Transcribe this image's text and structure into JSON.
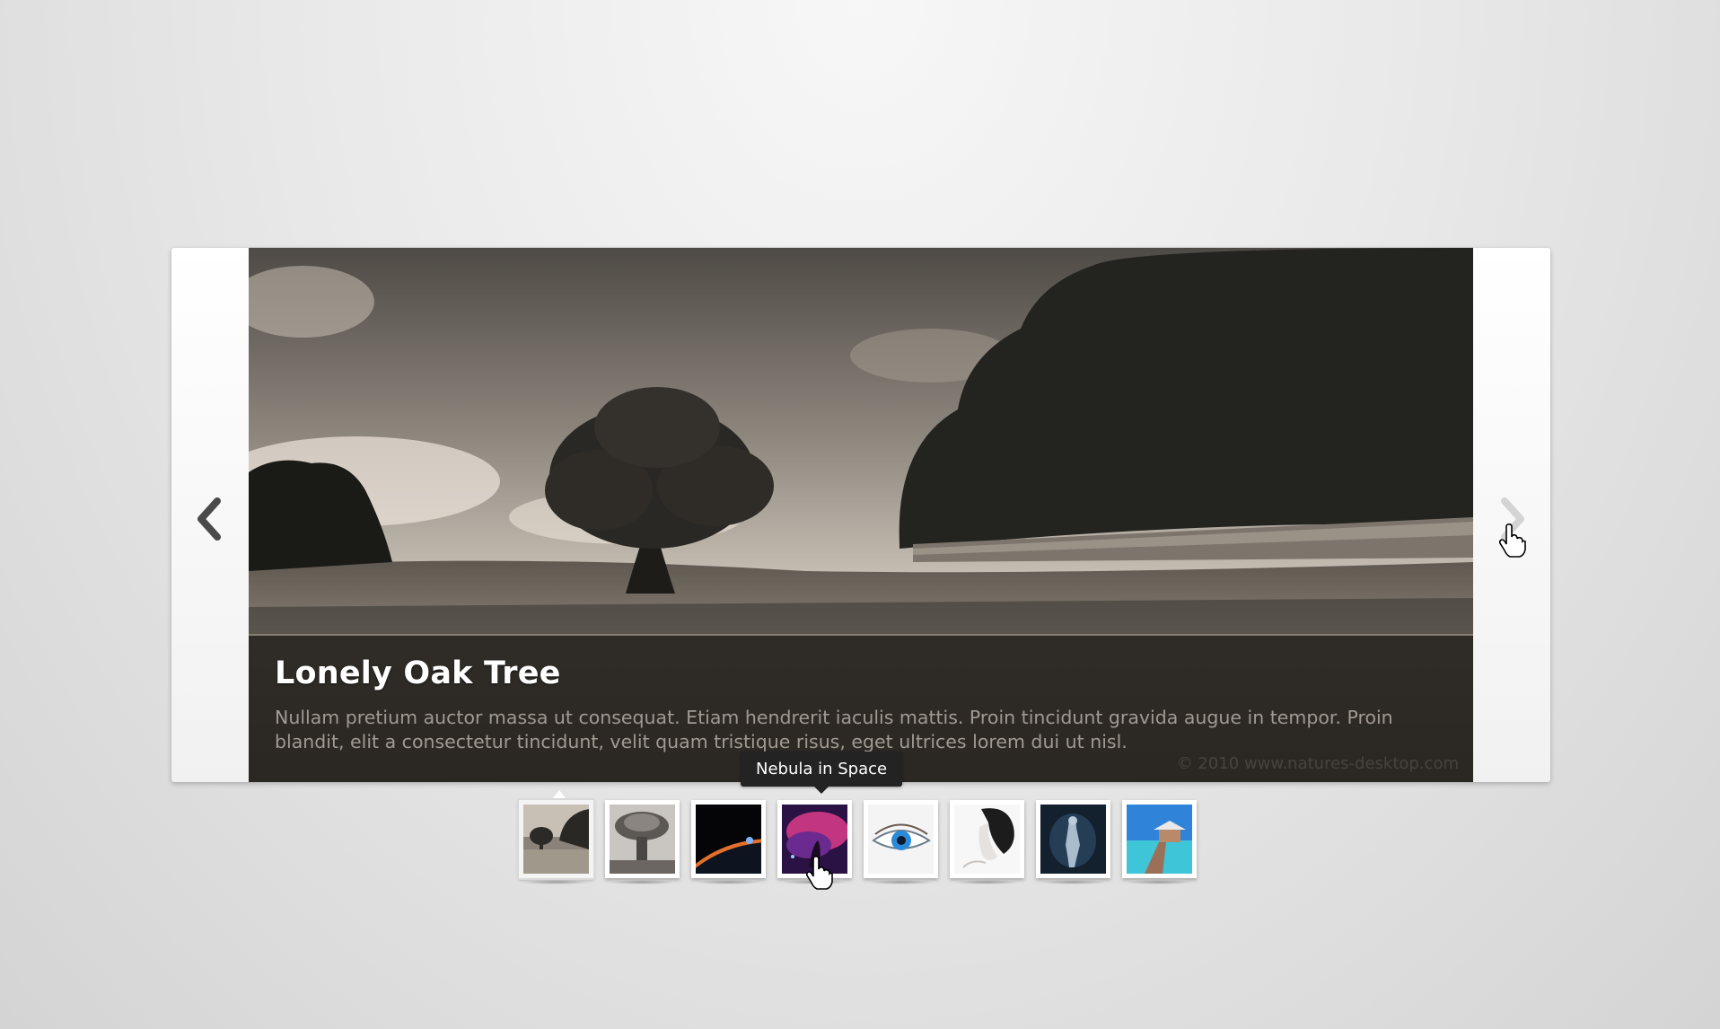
{
  "slide": {
    "title": "Lonely Oak Tree",
    "description": "Nullam pretium auctor massa ut consequat. Etiam hendrerit iaculis mattis. Proin tincidunt gravida augue in tempor. Proin blandit, elit a consectetur tincidunt, velit quam tristique risus, eget ultrices lorem dui ut nisl.",
    "copyright": "© 2010 www.natures-desktop.com"
  },
  "navigation": {
    "prev_icon": "chevron-left-icon",
    "next_icon": "chevron-right-icon"
  },
  "tooltip": {
    "text": "Nebula in Space"
  },
  "thumbnails": [
    {
      "subject": "oak-tree",
      "active": true
    },
    {
      "subject": "mushroom-explosion",
      "active": false
    },
    {
      "subject": "planet-horizon",
      "active": false
    },
    {
      "subject": "nebula",
      "active": false,
      "hovered": true
    },
    {
      "subject": "eye",
      "active": false
    },
    {
      "subject": "woman-profile",
      "active": false
    },
    {
      "subject": "figure-sculpture",
      "active": false
    },
    {
      "subject": "beach-pier",
      "active": false
    }
  ],
  "colors": {
    "caption_bg": "#201d1a",
    "tooltip_bg": "#232323",
    "page_bg": "#e9e9e9"
  }
}
